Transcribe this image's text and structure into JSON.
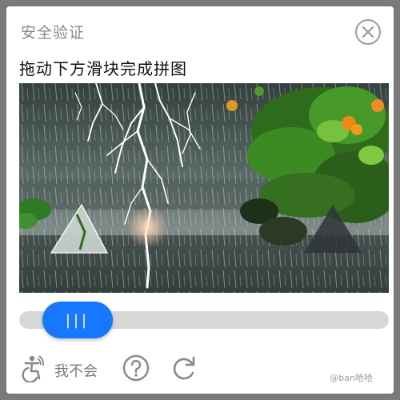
{
  "dialog": {
    "title": "安全验证",
    "instruction": "拖动下方滑块完成拼图"
  },
  "slider": {
    "handle_label": "|||",
    "progress": 0.09
  },
  "footer": {
    "dont_know_label": "我不会"
  },
  "watermark": "@ban哈哈",
  "icons": {
    "close": "close-icon",
    "accessibility": "accessibility-icon",
    "help": "question-icon",
    "refresh": "refresh-icon"
  },
  "colors": {
    "accent": "#1677ff",
    "track": "#d7d7d7",
    "title": "#8a8a8a",
    "text": "#111111"
  }
}
